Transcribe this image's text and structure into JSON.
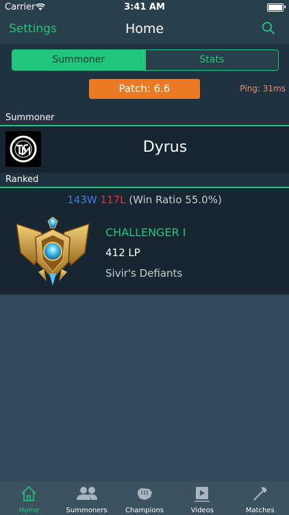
{
  "status_bar": {
    "carrier": "Carrier",
    "time": "3:41 AM"
  },
  "nav": {
    "left_label": "Settings",
    "title": "Home",
    "right_icon": "search-icon"
  },
  "segments": [
    {
      "label": "Summoner",
      "selected": true
    },
    {
      "label": "Stats",
      "selected": false
    }
  ],
  "patch": {
    "label": "Patch: 6.6"
  },
  "ping": {
    "label": "Ping: 31ms"
  },
  "summoner_section": {
    "header": "Summoner",
    "name": "Dyrus",
    "avatar": "tsm-logo"
  },
  "ranked_section": {
    "header": "Ranked",
    "wins": "143W",
    "losses": "117L",
    "ratio": "(Win Ratio 55.0%)",
    "tier": "CHALLENGER I",
    "lp": "412 LP",
    "league": "Sivir's Defiants",
    "emblem": "challenger-emblem"
  },
  "tabs": [
    {
      "label": "Home",
      "icon": "home-icon",
      "active": true
    },
    {
      "label": "Summoners",
      "icon": "people-icon",
      "active": false
    },
    {
      "label": "Champions",
      "icon": "fist-icon",
      "active": false
    },
    {
      "label": "Videos",
      "icon": "video-icon",
      "active": false
    },
    {
      "label": "Matches",
      "icon": "axe-icon",
      "active": false
    }
  ],
  "colors": {
    "accent": "#20c67b",
    "patch": "#eb7a25",
    "wins": "#3b7fe0",
    "losses": "#e23535"
  }
}
